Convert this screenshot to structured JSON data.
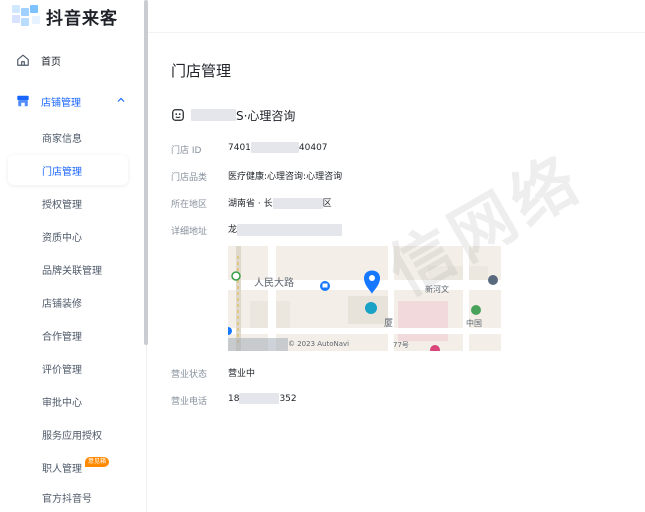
{
  "app": {
    "logo_text": "抖音来客"
  },
  "sidebar": {
    "home_label": "首页",
    "group_label": "店铺管理",
    "items": [
      {
        "label": "商家信息"
      },
      {
        "label": "门店管理"
      },
      {
        "label": "授权管理"
      },
      {
        "label": "资质中心"
      },
      {
        "label": "品牌关联管理"
      },
      {
        "label": "店铺装修"
      },
      {
        "label": "合作管理"
      },
      {
        "label": "评价管理"
      },
      {
        "label": "审批中心"
      },
      {
        "label": "服务应用授权"
      },
      {
        "label": "职人管理"
      },
      {
        "label": "官方抖音号"
      }
    ],
    "badge_text": "意见箱"
  },
  "main": {
    "page_title": "门店管理",
    "store_name_suffix": "S·心理咨询",
    "fields": {
      "store_id_label": "门店 ID",
      "store_id_prefix": "7401",
      "store_id_suffix": "40407",
      "category_label": "门店品类",
      "category_value": "医疗健康:心理咨询:心理咨询",
      "region_label": "所在地区",
      "region_prefix": "湖南省 · 长",
      "region_suffix": "区",
      "address_label": "详细地址",
      "address_prefix": "龙",
      "status_label": "营业状态",
      "status_value": "营业中",
      "phone_label": "营业电话",
      "phone_prefix": "18",
      "phone_suffix": "352"
    },
    "map": {
      "label_left": "人民大路",
      "label_right": "新河文",
      "label_br": "中国",
      "label_bottom": "厦",
      "copyright": "© 2023 AutoNavi",
      "copyright_suffix": "77号"
    }
  },
  "watermark": {
    "text": "信网络"
  },
  "colors": {
    "accent": "#1966ff",
    "badge": "#ff8a00",
    "pin": "#1677ff"
  }
}
